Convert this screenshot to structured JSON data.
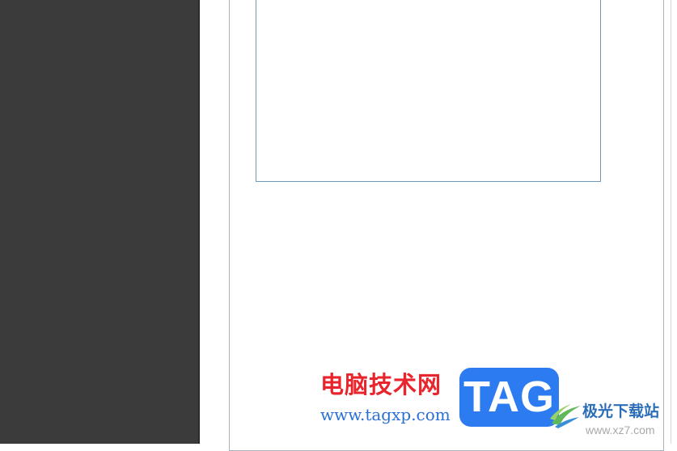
{
  "watermark": {
    "site_name": "电脑技术网",
    "site_url": "www.tagxp.com",
    "tag_label": "TAG",
    "download_site": "极光下载站",
    "download_url": "www.xz7.com"
  },
  "colors": {
    "panel": "#3b3b3b",
    "site_red": "#e8242d",
    "url_blue": "#2a6fd6",
    "tag_blue": "#2d7bf0",
    "frame_border": "#6f97b8"
  },
  "icons": {
    "download_logo": "aurora-swirl-icon"
  }
}
